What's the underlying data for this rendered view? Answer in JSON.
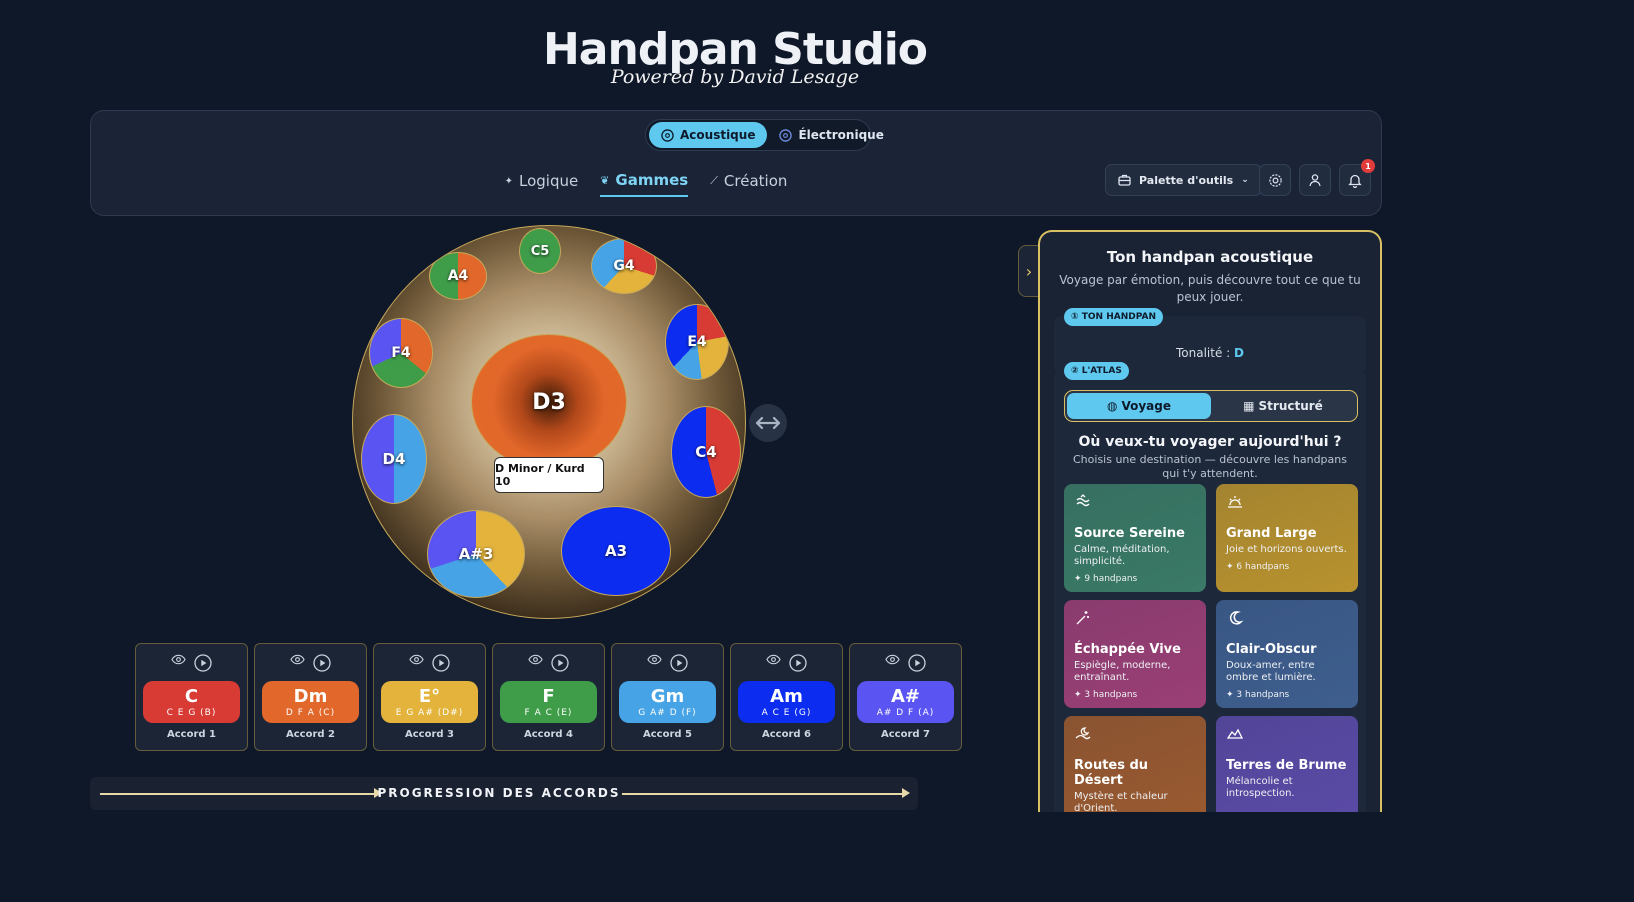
{
  "header": {
    "title": "Handpan Studio",
    "subtitle": "Powered by David Lesage"
  },
  "modes": {
    "acoustic": "Acoustique",
    "electronic": "Électronique"
  },
  "nav": {
    "logic": "Logique",
    "scales": "Gammes",
    "creation": "Création"
  },
  "toolbar": {
    "tools_label": "Palette d'outils",
    "notification_count": "1"
  },
  "handpan": {
    "center": "D3",
    "scale_label": "D Minor / Kurd 10",
    "notes": [
      "C5",
      "G4",
      "E4",
      "C4",
      "A3",
      "A#3",
      "D4",
      "F4",
      "A4"
    ]
  },
  "chords": [
    {
      "name": "C",
      "notes": "C E G (B)",
      "label": "Accord 1",
      "color": "#d83a34"
    },
    {
      "name": "Dm",
      "notes": "D F A (C)",
      "label": "Accord 2",
      "color": "#e2672a"
    },
    {
      "name": "E°",
      "notes": "E G A# (D#)",
      "label": "Accord 3",
      "color": "#e3b33c"
    },
    {
      "name": "F",
      "notes": "F A C (E)",
      "label": "Accord 4",
      "color": "#3f9d4a"
    },
    {
      "name": "Gm",
      "notes": "G A# D (F)",
      "label": "Accord 5",
      "color": "#45a3e6"
    },
    {
      "name": "Am",
      "notes": "A C E (G)",
      "label": "Accord 6",
      "color": "#0c2df0"
    },
    {
      "name": "A#",
      "notes": "A# D F (A)",
      "label": "Accord 7",
      "color": "#5a55f2"
    }
  ],
  "progression": {
    "label": "PROGRESSION DES ACCORDS"
  },
  "panel": {
    "title": "Ton handpan acoustique",
    "subtitle": "Voyage par émotion, puis découvre tout ce que tu peux jouer.",
    "step1": "① TON HANDPAN",
    "tonality_label": "Tonalité :",
    "tonality_value": "D",
    "step2": "② L'ATLAS",
    "tab_voyage": "Voyage",
    "tab_structured": "Structuré",
    "question": "Où veux-tu voyager aujourd'hui ?",
    "question_sub": "Choisis une destination — découvre les handpans qui t'y attendent.",
    "destinations": [
      {
        "title": "Source Sereine",
        "desc": "Calme, méditation, simplicité.",
        "count": "✦ 9 handpans",
        "icon": "waves-icon",
        "color": "#3a7a66"
      },
      {
        "title": "Grand Large",
        "desc": "Joie et horizons ouverts.",
        "count": "✦ 6 handpans",
        "icon": "sunrise-icon",
        "color": "#b8922e"
      },
      {
        "title": "Échappée Vive",
        "desc": "Espiègle, moderne, entraînant.",
        "count": "✦ 3 handpans",
        "icon": "sparkle-wand-icon",
        "color": "#9a3f76"
      },
      {
        "title": "Clair-Obscur",
        "desc": "Doux-amer, entre ombre et lumière.",
        "count": "✦ 3 handpans",
        "icon": "moon-icon",
        "color": "#3e5e8e"
      },
      {
        "title": "Routes du Désert",
        "desc": "Mystère et chaleur d'Orient.",
        "count": "",
        "icon": "desert-moon-icon",
        "color": "#9a5a30"
      },
      {
        "title": "Terres de Brume",
        "desc": "Mélancolie et introspection.",
        "count": "",
        "icon": "mountain-icon",
        "color": "#5a4aa6"
      }
    ]
  }
}
